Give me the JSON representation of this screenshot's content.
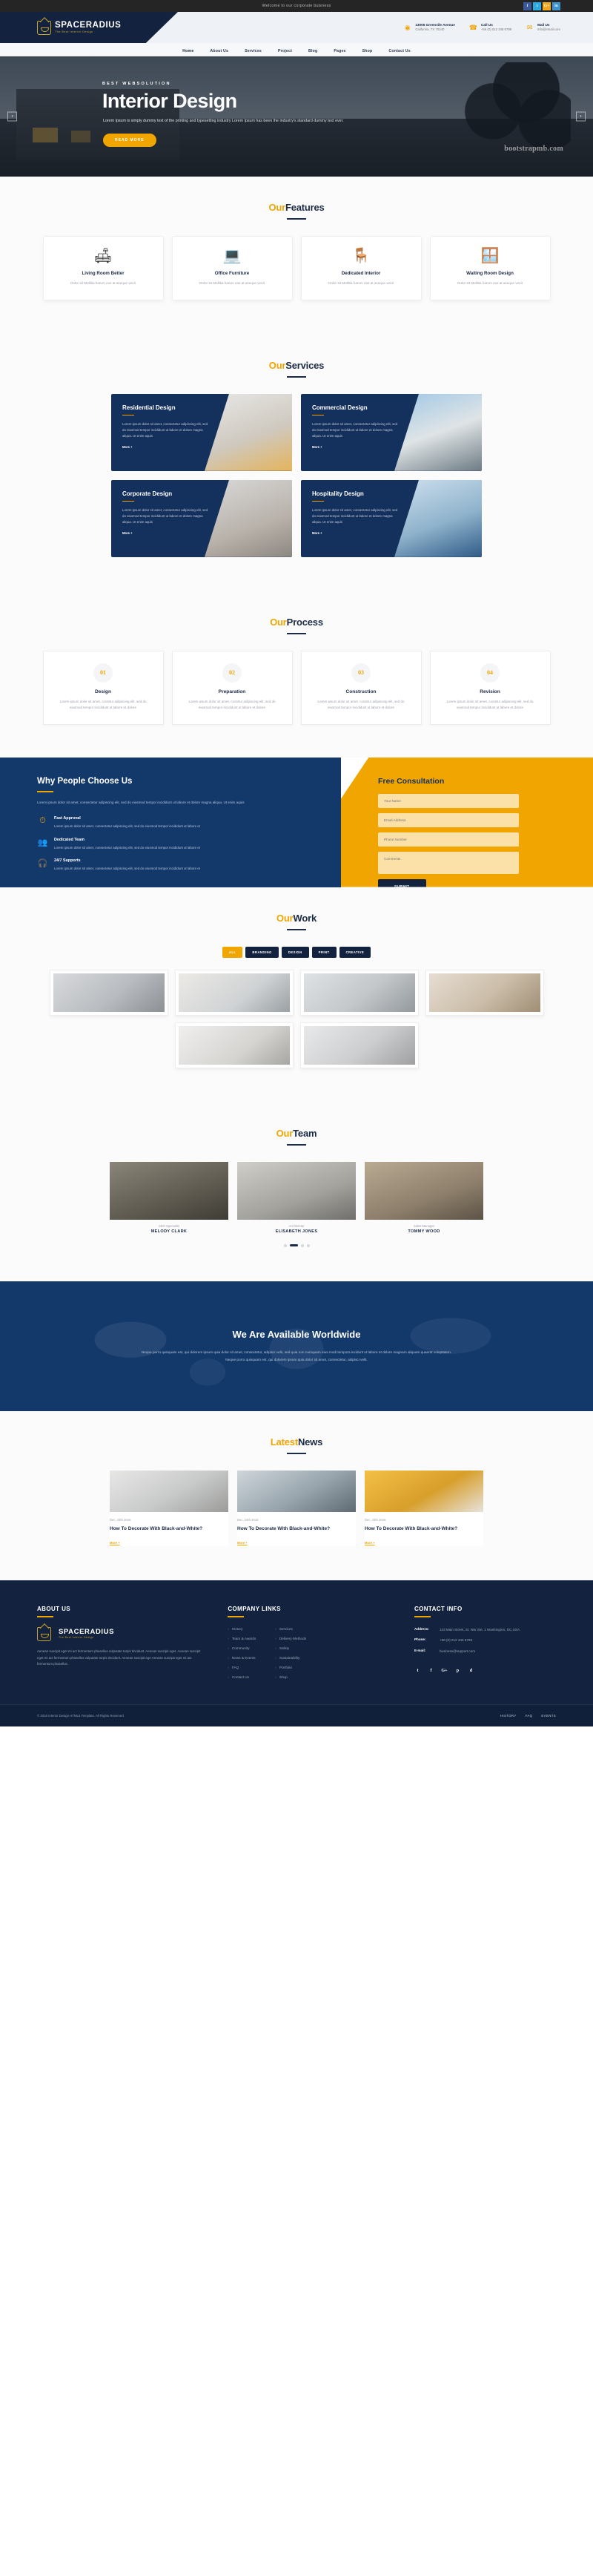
{
  "topbar": {
    "welcome": "Welcome to our corporate buisness",
    "social": [
      {
        "name": "facebook-icon",
        "glyph": "f",
        "color": "#3b5998"
      },
      {
        "name": "twitter-icon",
        "glyph": "t",
        "color": "#2daae1"
      },
      {
        "name": "google-plus-icon",
        "glyph": "G+",
        "color": "#f2a81d"
      },
      {
        "name": "linkedin-icon",
        "glyph": "in",
        "color": "#3f94cf"
      }
    ]
  },
  "brand": {
    "name": "SPACERADIUS",
    "tagline": "The Best Interior Design"
  },
  "header_info": [
    {
      "icon": "location-pin-icon",
      "glyph": "◉",
      "title": "13005 Greenvile Avenue",
      "sub": "California, TX 70240"
    },
    {
      "icon": "phone-icon",
      "glyph": "☎",
      "title": "Call Us",
      "sub": "+56 (0) 012 345 6789"
    },
    {
      "icon": "mail-icon",
      "glyph": "✉",
      "title": "Mail Us",
      "sub": "info@email.com"
    }
  ],
  "nav": [
    "Home",
    "About Us",
    "Services",
    "Project",
    "Blog",
    "Pages",
    "Shop",
    "Contact Us"
  ],
  "hero": {
    "subtitle": "BEST WEBSOLUTION",
    "title": "Interior Design",
    "desc": "Lorem Ipsum is simply dummy text of the printing and typesetting industry Lorem Ipsum has been the industry's standard dummy text ever.",
    "button": "READ MORE",
    "watermark": "bootstrapmb.com",
    "prev": "‹",
    "next": "›"
  },
  "features": {
    "title_light": "Our",
    "title_bold": "Features",
    "cards": [
      {
        "icon": "sofa-tv-icon",
        "glyph": "🛋",
        "title": "Living Room Better",
        "text": "Dolor sit Mollitia harum eos at aseque venit"
      },
      {
        "icon": "office-desk-icon",
        "glyph": "💻",
        "title": "Office Furniture",
        "text": "Dolor sit Mollitia harum eos at aseque venit"
      },
      {
        "icon": "armchair-lamp-icon",
        "glyph": "🪑",
        "title": "Dedicated Interior",
        "text": "Dolor sit Mollitia harum eos at aseque venit"
      },
      {
        "icon": "dining-table-icon",
        "glyph": "🪟",
        "title": "Waiting Room Design",
        "text": "Dolor sit Mollitia harum eos at aseque venit"
      }
    ]
  },
  "services": {
    "title_light": "Our",
    "title_bold": "Services",
    "more_label": "More +",
    "cards": [
      {
        "title": "Residential Design",
        "text": "Lorem ipsum dolor sit amet, consectetur adipiscing elit, sed do eiusmod tempor incididunt ut labore et dolore magna aliqua. Ut enim aquis"
      },
      {
        "title": "Commercial Design",
        "text": "Lorem ipsum dolor sit amet, consectetur adipiscing elit, sed do eiusmod tempor incididunt ut labore et dolore magna aliqua. Ut enim aquis"
      },
      {
        "title": "Corporate Design",
        "text": "Lorem ipsum dolor sit amet, consectetur adipiscing elit, sed do eiusmod tempor incididunt ut labore et dolore magna aliqua. Ut enim aquis"
      },
      {
        "title": "Hospitality Design",
        "text": "Lorem ipsum dolor sit amet, consectetur adipiscing elit, sed do eiusmod tempor incididunt ut labore et dolore magna aliqua. Ut enim aquis"
      }
    ]
  },
  "process": {
    "title_light": "Our",
    "title_bold": "Process",
    "steps": [
      {
        "num": "01",
        "title": "Design",
        "text": "Lorem ipsum dolor sit amet, coctetur adipiscing elit, sed do eiusmod tempor incididunt ut labore et dolore"
      },
      {
        "num": "02",
        "title": "Preparation",
        "text": "Lorem ipsum dolor sit amet, coctetur adipiscing elit, sed do eiusmod tempor incididunt ut labore et dolore"
      },
      {
        "num": "03",
        "title": "Construction",
        "text": "Lorem ipsum dolor sit amet, coctetur adipiscing elit, sed do eiusmod tempor incididunt ut labore et dolore"
      },
      {
        "num": "04",
        "title": "Revision",
        "text": "Lorem ipsum dolor sit amet, coctetur adipiscing elit, sed do eiusmod tempor incididunt ut labore et dolore"
      }
    ]
  },
  "why": {
    "title": "Why People Choose Us",
    "intro": "Lorem ipsum dolor sit amet, consectetur adipiscing elit, sed do eiusmod tempor incididunt ut labore et dolore magna aliqua. Ut enim aquis",
    "items": [
      {
        "icon": "speedometer-icon",
        "glyph": "⏱",
        "title": "Fast Approval",
        "text": "Lorem ipsum dolor sit amet, consectetur adipiscing elit, sed do eiusmod tempor incididunt ut labore et"
      },
      {
        "icon": "team-icon",
        "glyph": "👥",
        "title": "Dedicated Team",
        "text": "Lorem ipsum dolor sit amet, consectetur adipiscing elit, sed do eiusmod tempor incididunt ut labore et"
      },
      {
        "icon": "support-headset-icon",
        "glyph": "🎧",
        "title": "24/7 Supports",
        "text": "Lorem ipsum dolor sit amet, consectetur adipiscing elit, sed do eiusmod tempor incididunt ut labore et"
      }
    ]
  },
  "consultation": {
    "title": "Free Consultation",
    "fields": [
      {
        "name": "full-name-input",
        "placeholder": "Your Name"
      },
      {
        "name": "email-input",
        "placeholder": "Email Address"
      },
      {
        "name": "phone-input",
        "placeholder": "Phone Number"
      }
    ],
    "message_placeholder": "Comments",
    "submit": "SUBMIT"
  },
  "work": {
    "title_light": "Our",
    "title_bold": "Work",
    "filters": [
      "ALL",
      "BRANDING",
      "DESIGN",
      "PRINT",
      "CREATIVE"
    ],
    "active_filter": "ALL",
    "tiles": [
      {
        "name": "work-tile-1"
      },
      {
        "name": "work-tile-2"
      },
      {
        "name": "work-tile-3"
      },
      {
        "name": "work-tile-4"
      },
      {
        "name": "work-tile-5"
      },
      {
        "name": "work-tile-6"
      }
    ]
  },
  "team": {
    "title_light": "Our",
    "title_bold": "Team",
    "members": [
      {
        "role": "SEO Specialist",
        "name": "MELODY CLARK"
      },
      {
        "role": "Art Director",
        "name": "ELISABETH JONES"
      },
      {
        "role": "Sales Manager",
        "name": "TOMMY WOOD"
      }
    ]
  },
  "worldwide": {
    "title": "We Are Available Worldwide",
    "text": "Neque porro quisquam est, qui dolorem ipsum quia dolor sit amet, consectetur, adipisci velit, sed quia non numquam eius modi tempora incidunt ut labore et dolore magnam aliquam quaerat voluptatem. Neque porro quisquam est, qui dolorem ipsum quia dolor sit amet, consectetur, adipisci velit."
  },
  "news": {
    "title_light": "Latest",
    "title_bold": "News",
    "more_label": "More +",
    "posts": [
      {
        "date": "Dec, 24th 2018",
        "title": "How To Decorate With Black-and-White?"
      },
      {
        "date": "Dec, 24th 2018",
        "title": "How To Decorate With Black-and-White?"
      },
      {
        "date": "Dec, 24th 2018",
        "title": "How To Decorate With Black-and-White?"
      }
    ]
  },
  "footer": {
    "about": {
      "heading": "ABOUT US",
      "text": "Aenean suscipit eget mi act fermentum phasellus vulputate turpis tincidunt. Aenean suscipit eget. Aenean suscipit eget mi act fermentum phasellus vulputate turpis tincidunt. Aenean suscipit ege Aenean suscipit eget mi act fermentum phasellus."
    },
    "links": {
      "heading": "COMPANY LINKS",
      "col1": [
        "History",
        "Team & Awards",
        "Community",
        "News & Events",
        "FAQ",
        "Contact Us"
      ],
      "col2": [
        "Services",
        "Delivery Methods",
        "Safety",
        "Sustainability",
        "Portfolio",
        "Shop"
      ]
    },
    "contact": {
      "heading": "CONTACT INFO",
      "rows": [
        {
          "label": "Address:",
          "value": "123 Main Street, St. NW Ste, 1 Washington, DC,USA"
        },
        {
          "label": "Phone:",
          "value": "+56 (0) 012 345 6789"
        },
        {
          "label": "E-mail:",
          "value": "business@support.com"
        }
      ],
      "social": [
        {
          "name": "twitter-icon",
          "glyph": "t"
        },
        {
          "name": "facebook-icon",
          "glyph": "f"
        },
        {
          "name": "google-plus-icon",
          "glyph": "G+"
        },
        {
          "name": "pinterest-icon",
          "glyph": "p"
        },
        {
          "name": "dribbble-icon",
          "glyph": "d"
        }
      ]
    },
    "copyright": "© 2018 Interior Design HTML5 Template. All Rights Reserved",
    "bottom_links": [
      "HISTORY",
      "FAQ",
      "EVENTS"
    ]
  }
}
